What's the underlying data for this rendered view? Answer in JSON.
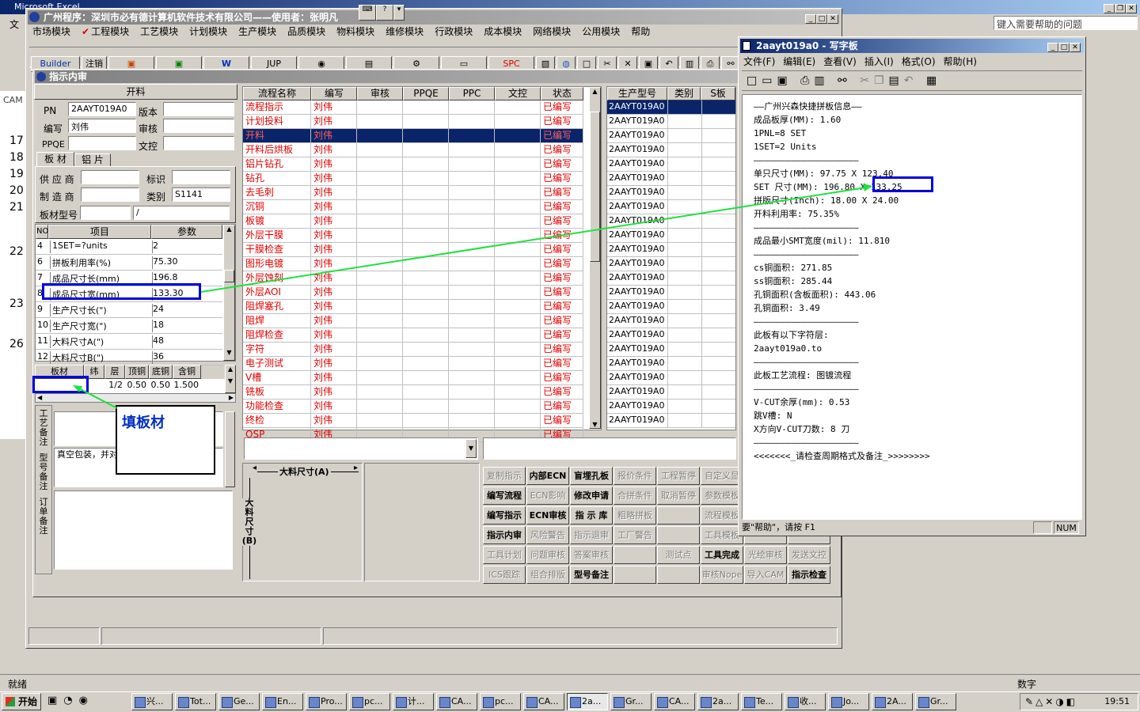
{
  "excel": {
    "title": "Microsoft Excel",
    "menu_first": "文",
    "help_placeholder": "键入需要帮助的问题",
    "row_numbers": [
      "17",
      "18",
      "19",
      "20",
      "21",
      "22",
      "23",
      "26"
    ],
    "status": "就绪",
    "num_indicator": "数字",
    "cam_label": "CAM"
  },
  "app": {
    "title": "广州程序：深圳市必有德计算机软件技术有限公司——使用者：张明凡",
    "menu": [
      "市场模块",
      "工程模块",
      "工艺模块",
      "计划模块",
      "生产模块",
      "品质模块",
      "物料模块",
      "维修模块",
      "行政模块",
      "成本模块",
      "网络模块",
      "公用模块",
      "帮助"
    ],
    "toolbar": {
      "builder": "Builder",
      "zhuxiao": "注销",
      "jup": "JUP",
      "spc": "SPC"
    }
  },
  "panel": {
    "title": "指示内审",
    "kailiao_header": "开料",
    "pn_label": "PN",
    "pn_value": "2AAYT019A0",
    "banben_label": "版本",
    "bianxie_label": "编写",
    "bianxie_value": "刘伟",
    "shenhe_label": "审核",
    "ppqe_label": "PPQE",
    "wenkong_label": "文控",
    "tab_bancai": "板 材",
    "tab_lupian": "铝 片",
    "gongyingshang_label": "供 应 商",
    "biaoshi_label": "标识",
    "zhizaoshang_label": "制 造 商",
    "leibie_label": "类别",
    "leibie_value": "S1141",
    "bancaixinghao_label": "板材型号",
    "bancaixinghao_value2": "/",
    "params_header": {
      "no": "NO",
      "item": "项目",
      "value": "参数"
    },
    "params": [
      {
        "no": "4",
        "item": "1SET=?units",
        "value": "2"
      },
      {
        "no": "6",
        "item": "拼板利用率(%)",
        "value": "75.30"
      },
      {
        "no": "7",
        "item": "成品尺寸长(mm)",
        "value": "196.8"
      },
      {
        "no": "8",
        "item": "成品尺寸宽(mm)",
        "value": "133.30"
      },
      {
        "no": "9",
        "item": "生产尺寸长(\")",
        "value": "24"
      },
      {
        "no": "10",
        "item": "生产尺寸宽(\")",
        "value": "18"
      },
      {
        "no": "11",
        "item": "大料尺寸A(\")",
        "value": "48"
      },
      {
        "no": "12",
        "item": "大料尺寸B(\")",
        "value": "36"
      }
    ],
    "layer_header": [
      "板材",
      "纬",
      "层",
      "顶铜",
      "底铜",
      "含铜mm"
    ],
    "layer_row": [
      "",
      "",
      "1/2",
      "0.50",
      "0.50",
      "1.500"
    ],
    "side_labels": [
      "工艺备注",
      "型号备注",
      "订单备注"
    ],
    "note_text": "真空包装，并对……镀 具体见附图",
    "callout_text": "填板材"
  },
  "flow": {
    "headers": [
      "流程名称",
      "编写",
      "审核",
      "PPQE",
      "PPC",
      "文控",
      "状态"
    ],
    "rows": [
      {
        "name": "流程指示",
        "writer": "刘伟",
        "status": "已编写"
      },
      {
        "name": "计划投料",
        "writer": "刘伟",
        "status": "已编写"
      },
      {
        "name": "开料",
        "writer": "刘伟",
        "status": "已编写"
      },
      {
        "name": "开料后烘板",
        "writer": "刘伟",
        "status": "已编写"
      },
      {
        "name": "铝片钻孔",
        "writer": "刘伟",
        "status": "已编写"
      },
      {
        "name": "钻孔",
        "writer": "刘伟",
        "status": "已编写"
      },
      {
        "name": "去毛刺",
        "writer": "刘伟",
        "status": "已编写"
      },
      {
        "name": "沉铜",
        "writer": "刘伟",
        "status": "已编写"
      },
      {
        "name": "板镀",
        "writer": "刘伟",
        "status": "已编写"
      },
      {
        "name": "外层干膜",
        "writer": "刘伟",
        "status": "已编写"
      },
      {
        "name": "干膜检查",
        "writer": "刘伟",
        "status": "已编写"
      },
      {
        "name": "图形电镀",
        "writer": "刘伟",
        "status": "已编写"
      },
      {
        "name": "外层蚀刻",
        "writer": "刘伟",
        "status": "已编写"
      },
      {
        "name": "外层AOI",
        "writer": "刘伟",
        "status": "已编写"
      },
      {
        "name": "阻焊塞孔",
        "writer": "刘伟",
        "status": "已编写"
      },
      {
        "name": "阻焊",
        "writer": "刘伟",
        "status": "已编写"
      },
      {
        "name": "阻焊检查",
        "writer": "刘伟",
        "status": "已编写"
      },
      {
        "name": "字符",
        "writer": "刘伟",
        "status": "已编写"
      },
      {
        "name": "电子测试",
        "writer": "刘伟",
        "status": "已编写"
      },
      {
        "name": "V槽",
        "writer": "刘伟",
        "status": "已编写"
      },
      {
        "name": "铣板",
        "writer": "刘伟",
        "status": "已编写"
      },
      {
        "name": "功能检查",
        "writer": "刘伟",
        "status": "已编写"
      },
      {
        "name": "终检",
        "writer": "刘伟",
        "status": "已编写"
      },
      {
        "name": "OSP",
        "writer": "刘伟",
        "status": "已编写"
      }
    ]
  },
  "models": {
    "headers": [
      "生产型号",
      "类别",
      "S板"
    ],
    "rows": [
      "2AAYT019A0",
      "2AAYT019A0",
      "2AAYT019A0",
      "2AAYT019A0",
      "2AAYT019A0",
      "2AAYT019A0",
      "2AAYT019A0",
      "2AAYT019A0",
      "2AAYT019A0",
      "2AAYT019A0",
      "2AAYT019A0",
      "2AAYT019A0",
      "2AAYT019A0",
      "2AAYT019A0",
      "2AAYT019A0",
      "2AAYT019A0",
      "2AAYT019A0",
      "2AAYT019A0",
      "2AAYT019A0",
      "2AAYT019A0",
      "2AAYT019A0",
      "2AAYT019A0",
      "2AAYT019A0"
    ]
  },
  "diagram": {
    "a_label": "大料尺寸(A)",
    "b_label": "大料尺寸(B)"
  },
  "buttons": [
    {
      "label": "复制指示",
      "enabled": false
    },
    {
      "label": "内部ECN",
      "enabled": true
    },
    {
      "label": "盲埋孔板",
      "enabled": true
    },
    {
      "label": "报价条件",
      "enabled": false
    },
    {
      "label": "工程暂停",
      "enabled": false
    },
    {
      "label": "自定义显",
      "enabled": false
    },
    {
      "label": "编写流程",
      "enabled": true
    },
    {
      "label": "ECN影响",
      "enabled": false
    },
    {
      "label": "修改申请",
      "enabled": true
    },
    {
      "label": "合拼条件",
      "enabled": false
    },
    {
      "label": "取消暂停",
      "enabled": false
    },
    {
      "label": "参数模板",
      "enabled": false
    },
    {
      "label": "编写指示",
      "enabled": true
    },
    {
      "label": "ECN审核",
      "enabled": true
    },
    {
      "label": "指 示 库",
      "enabled": true
    },
    {
      "label": "粗略拼板",
      "enabled": false
    },
    {
      "label": "",
      "enabled": false
    },
    {
      "label": "流程模板",
      "enabled": false
    },
    {
      "label": "指示内审",
      "enabled": true
    },
    {
      "label": "风险警告",
      "enabled": false
    },
    {
      "label": "指示退审",
      "enabled": false
    },
    {
      "label": "工厂警告",
      "enabled": false
    },
    {
      "label": "",
      "enabled": false
    },
    {
      "label": "工具模板",
      "enabled": false
    },
    {
      "label": "工具计划",
      "enabled": false
    },
    {
      "label": "问题审核",
      "enabled": false
    },
    {
      "label": "答案审核",
      "enabled": false
    },
    {
      "label": "",
      "enabled": false
    },
    {
      "label": "测试点",
      "enabled": false
    },
    {
      "label": "工具完成",
      "enabled": true
    },
    {
      "label": "光绘审核",
      "enabled": false
    },
    {
      "label": "发送文控",
      "enabled": false
    },
    {
      "label": "ICS跟踪",
      "enabled": false
    },
    {
      "label": "组合排版",
      "enabled": false
    },
    {
      "label": "型号备注",
      "enabled": true
    },
    {
      "label": "",
      "enabled": false
    },
    {
      "label": "",
      "enabled": false
    },
    {
      "label": "审核Nope",
      "enabled": false
    },
    {
      "label": "导入CAM",
      "enabled": false
    },
    {
      "label": "指示检查",
      "enabled": true
    }
  ],
  "wordpad": {
    "title": "2aayt019a0 - 写字板",
    "menu": [
      "文件(F)",
      "编辑(E)",
      "查看(V)",
      "插入(I)",
      "格式(O)",
      "帮助(H)"
    ],
    "lines": [
      "——广州兴森快捷拼板信息——",
      "成品板厚(MM): 1.60",
      "1PNL=8 SET",
      "1SET=2 Units",
      "————————————————————",
      "单只尺寸(MM): 97.75 X 123.40",
      "SET 尺寸(MM): 196.80 X 133.25",
      "拼版尺寸(Inch): 18.00 X 24.00",
      "开料利用率: 75.35%",
      "————————————————————",
      "成品最小SMT宽度(mil): 11.810",
      "————————————————————",
      "cs铜面积: 271.85",
      "ss铜面积: 285.44",
      "孔铜面积(含板面积): 443.06",
      "孔铜面积: 3.49",
      "————————————————————",
      "此板有以下字符层:",
      "2aayt019a0.to",
      "————————————————————",
      "此板工艺流程: 图镀流程",
      "————————————————————",
      "V-CUT余厚(mm): 0.53",
      "跳V槽: N",
      "X方向V-CUT刀数: 8 刀",
      "————————————————————",
      "<<<<<<<_请检查周期格式及备注_>>>>>>>>"
    ],
    "status": "要\"帮助\"，请按 F1",
    "num": "NUM"
  },
  "taskbar": {
    "start": "开始",
    "items": [
      "兴...",
      "Tot...",
      "Ge...",
      "En...",
      "Pro...",
      "pc...",
      "计...",
      "CA...",
      "pc...",
      "CA...",
      "2a...",
      "Gr...",
      "CA...",
      "2a...",
      "Te...",
      "收...",
      "Jo...",
      "2A...",
      "Gr..."
    ],
    "clock": "19:51"
  },
  "colors": {
    "accent_blue": "#0a246a",
    "flow_red": "#e00000",
    "callout_blue": "#0000e0",
    "arrow_green": "#20d040",
    "title_grad_end": "#a6caf0"
  }
}
